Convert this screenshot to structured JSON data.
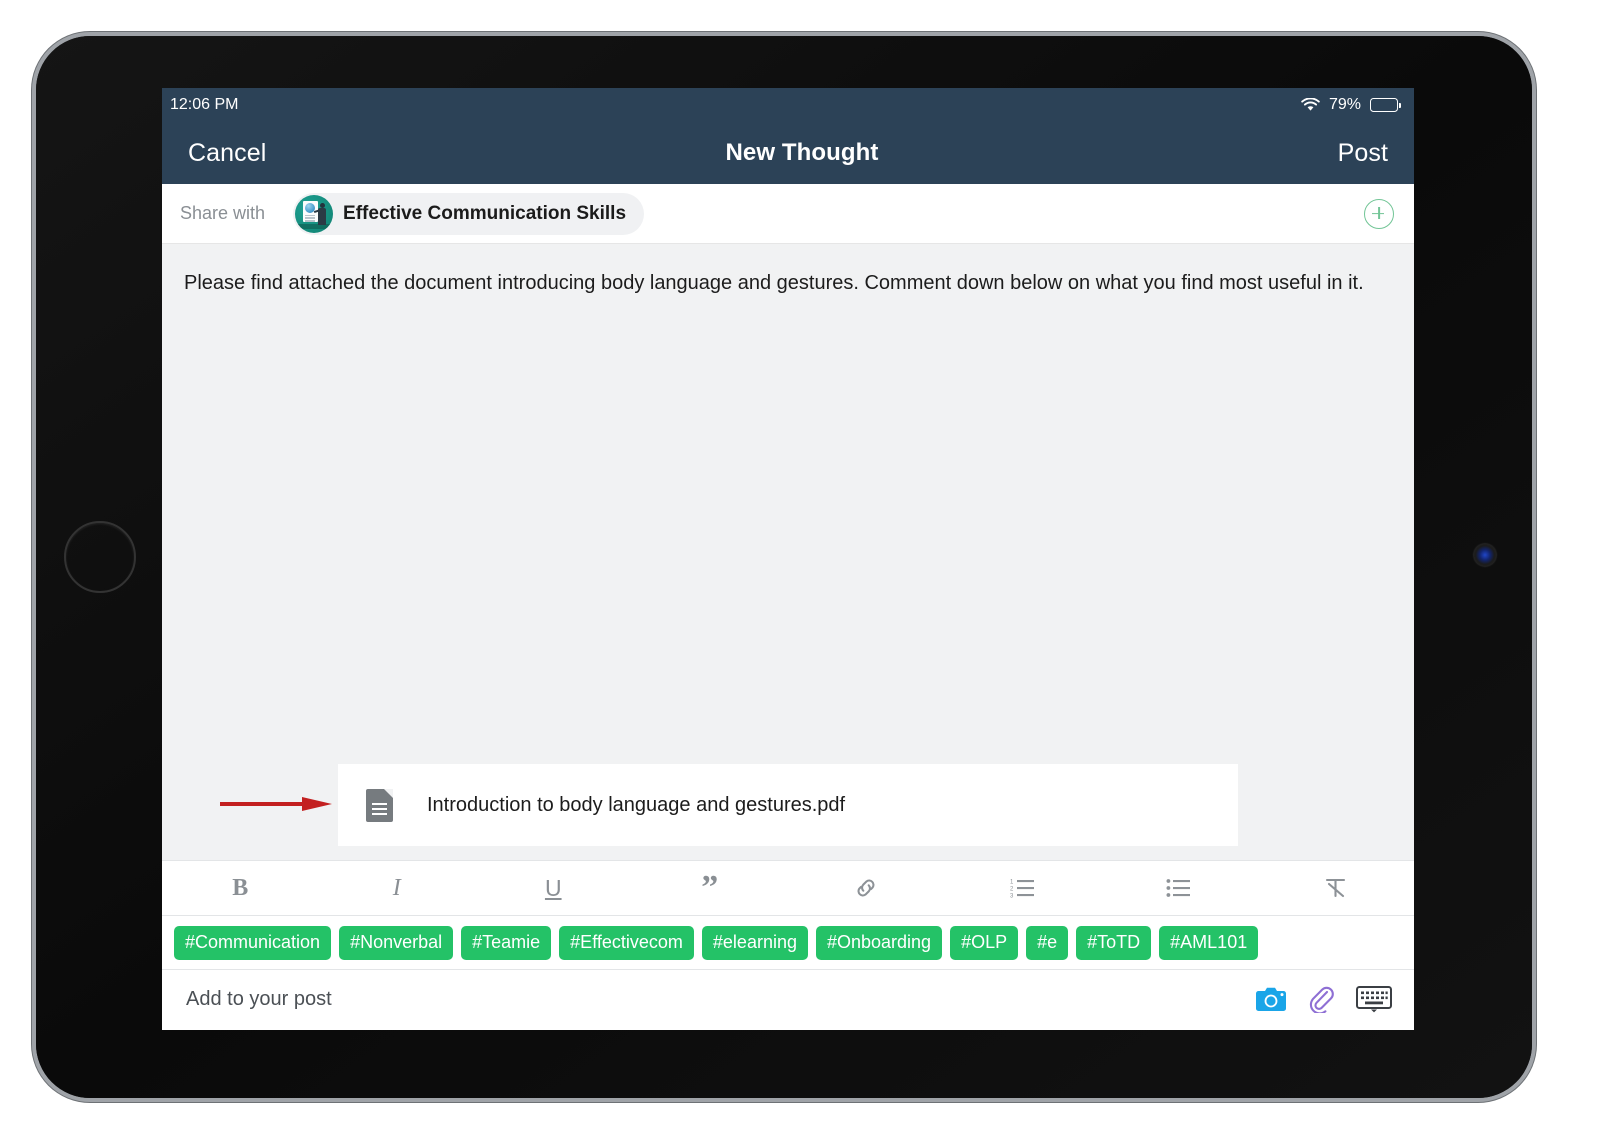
{
  "status_bar": {
    "time": "12:06 PM",
    "wifi_icon": "wifi-icon",
    "battery_percent": "79%",
    "battery_level": 79
  },
  "nav_bar": {
    "cancel_label": "Cancel",
    "title": "New Thought",
    "post_label": "Post",
    "background_color": "#2c4257"
  },
  "share_row": {
    "label": "Share with",
    "group_name": "Effective Communication Skills",
    "avatar_icon": "group-avatar-presenter",
    "add_button_icon": "plus-circle-icon"
  },
  "editor": {
    "body_text": "Please find attached the document introducing body language and gestures. Comment down below on what you find most useful in it.",
    "attachment": {
      "file_name": "Introduction to body language and gestures.pdf",
      "file_icon": "document-file-icon"
    },
    "annotation": {
      "type": "arrow",
      "color": "#c32020",
      "points_to": "attachment-card"
    }
  },
  "format_toolbar": {
    "buttons": [
      {
        "name": "bold-button",
        "glyph": "B"
      },
      {
        "name": "italic-button",
        "glyph": "I"
      },
      {
        "name": "underline-button",
        "glyph": "U"
      },
      {
        "name": "quote-button",
        "glyph": "”"
      },
      {
        "name": "link-button",
        "glyph": "link-icon"
      },
      {
        "name": "numbered-list-button",
        "glyph": "ordered-list-icon"
      },
      {
        "name": "bullet-list-button",
        "glyph": "unordered-list-icon"
      },
      {
        "name": "clear-formatting-button",
        "glyph": "clear-format-icon"
      }
    ]
  },
  "hashtags": {
    "accent_color": "#24c267",
    "items": [
      "#Communication",
      "#Nonverbal",
      "#Teamie",
      "#Effectivecom",
      "#elearning",
      "#Onboarding",
      "#OLP",
      "#e",
      "#ToTD",
      "#AML101"
    ]
  },
  "bottom_bar": {
    "placeholder": "Add to your post",
    "actions": [
      {
        "name": "camera-icon",
        "color": "#1aa5e8"
      },
      {
        "name": "paperclip-icon",
        "color": "#8e6fd4"
      },
      {
        "name": "keyboard-icon",
        "color": "#3b3f44"
      }
    ]
  }
}
